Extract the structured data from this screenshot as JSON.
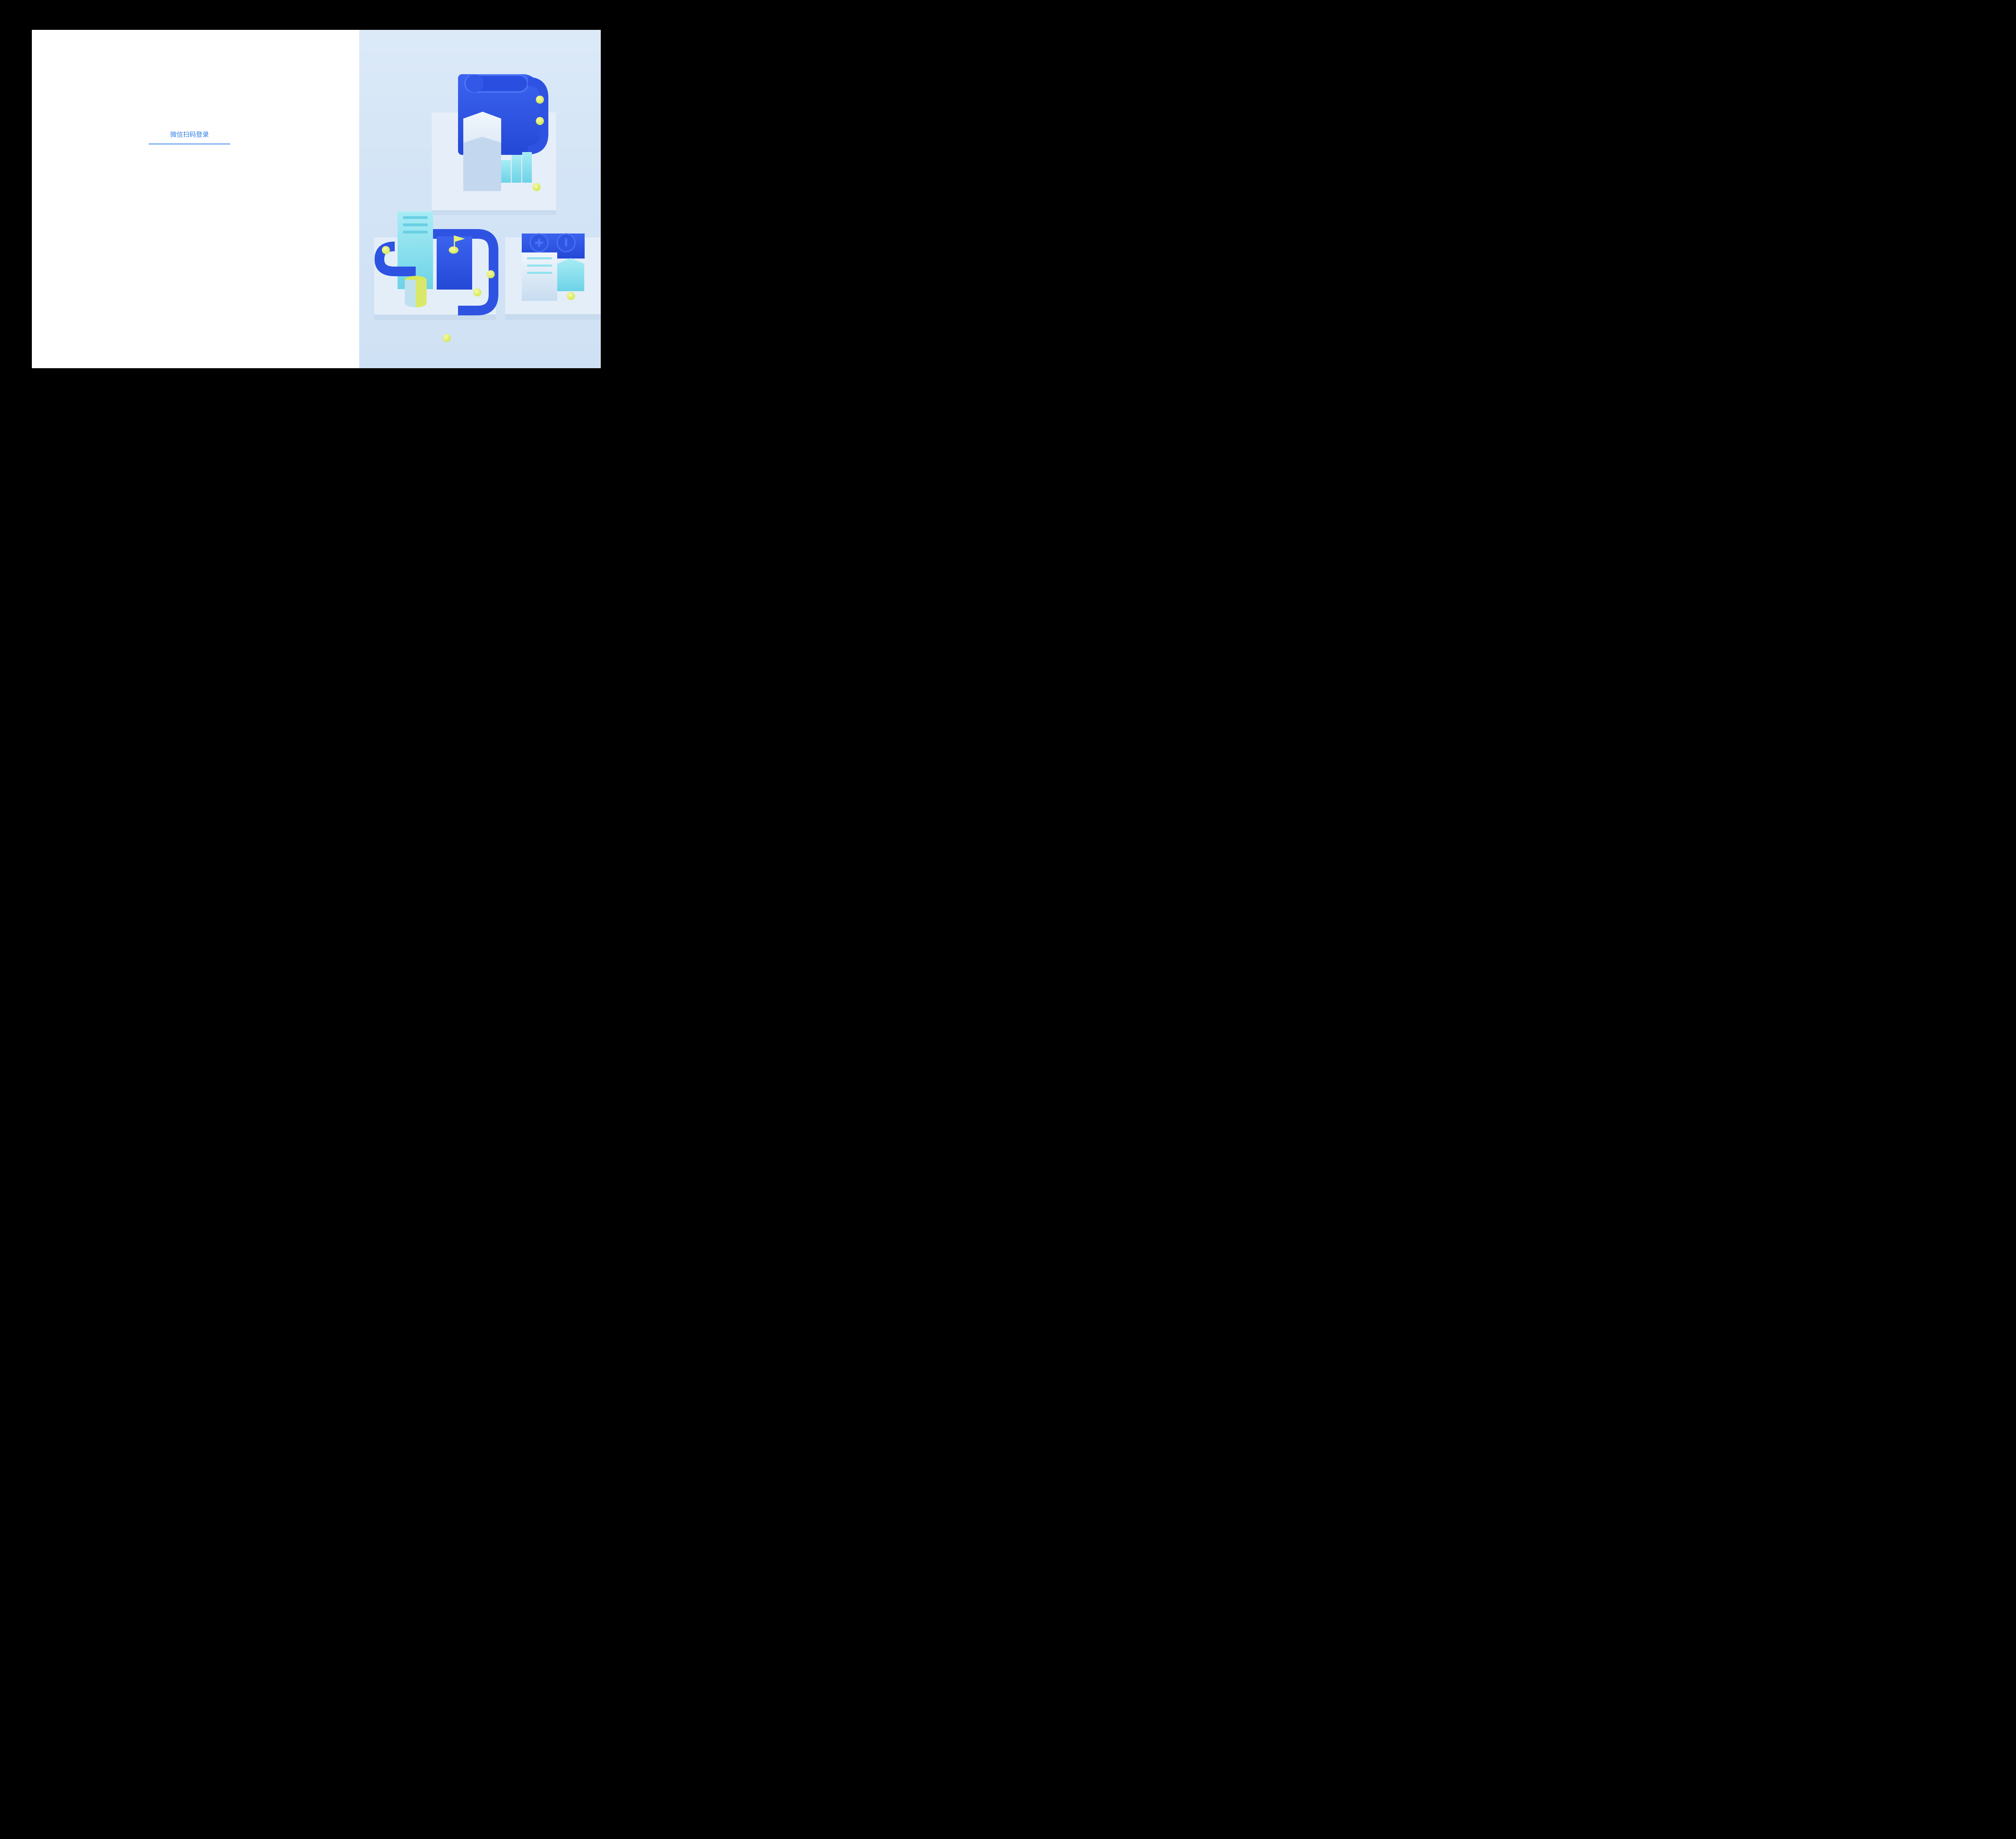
{
  "login": {
    "tab_label": "微信扫码登录",
    "accent_color": "#2f7ee6"
  },
  "illustration": {
    "description_icon": "isometric-blue-buildings-illustration",
    "colors": {
      "background": "#d6e7f7",
      "primary_blue": "#2d55e3",
      "light_cyan": "#8fe3ef",
      "yellow": "#e3ef6a",
      "platform": "#e4eef9"
    }
  }
}
